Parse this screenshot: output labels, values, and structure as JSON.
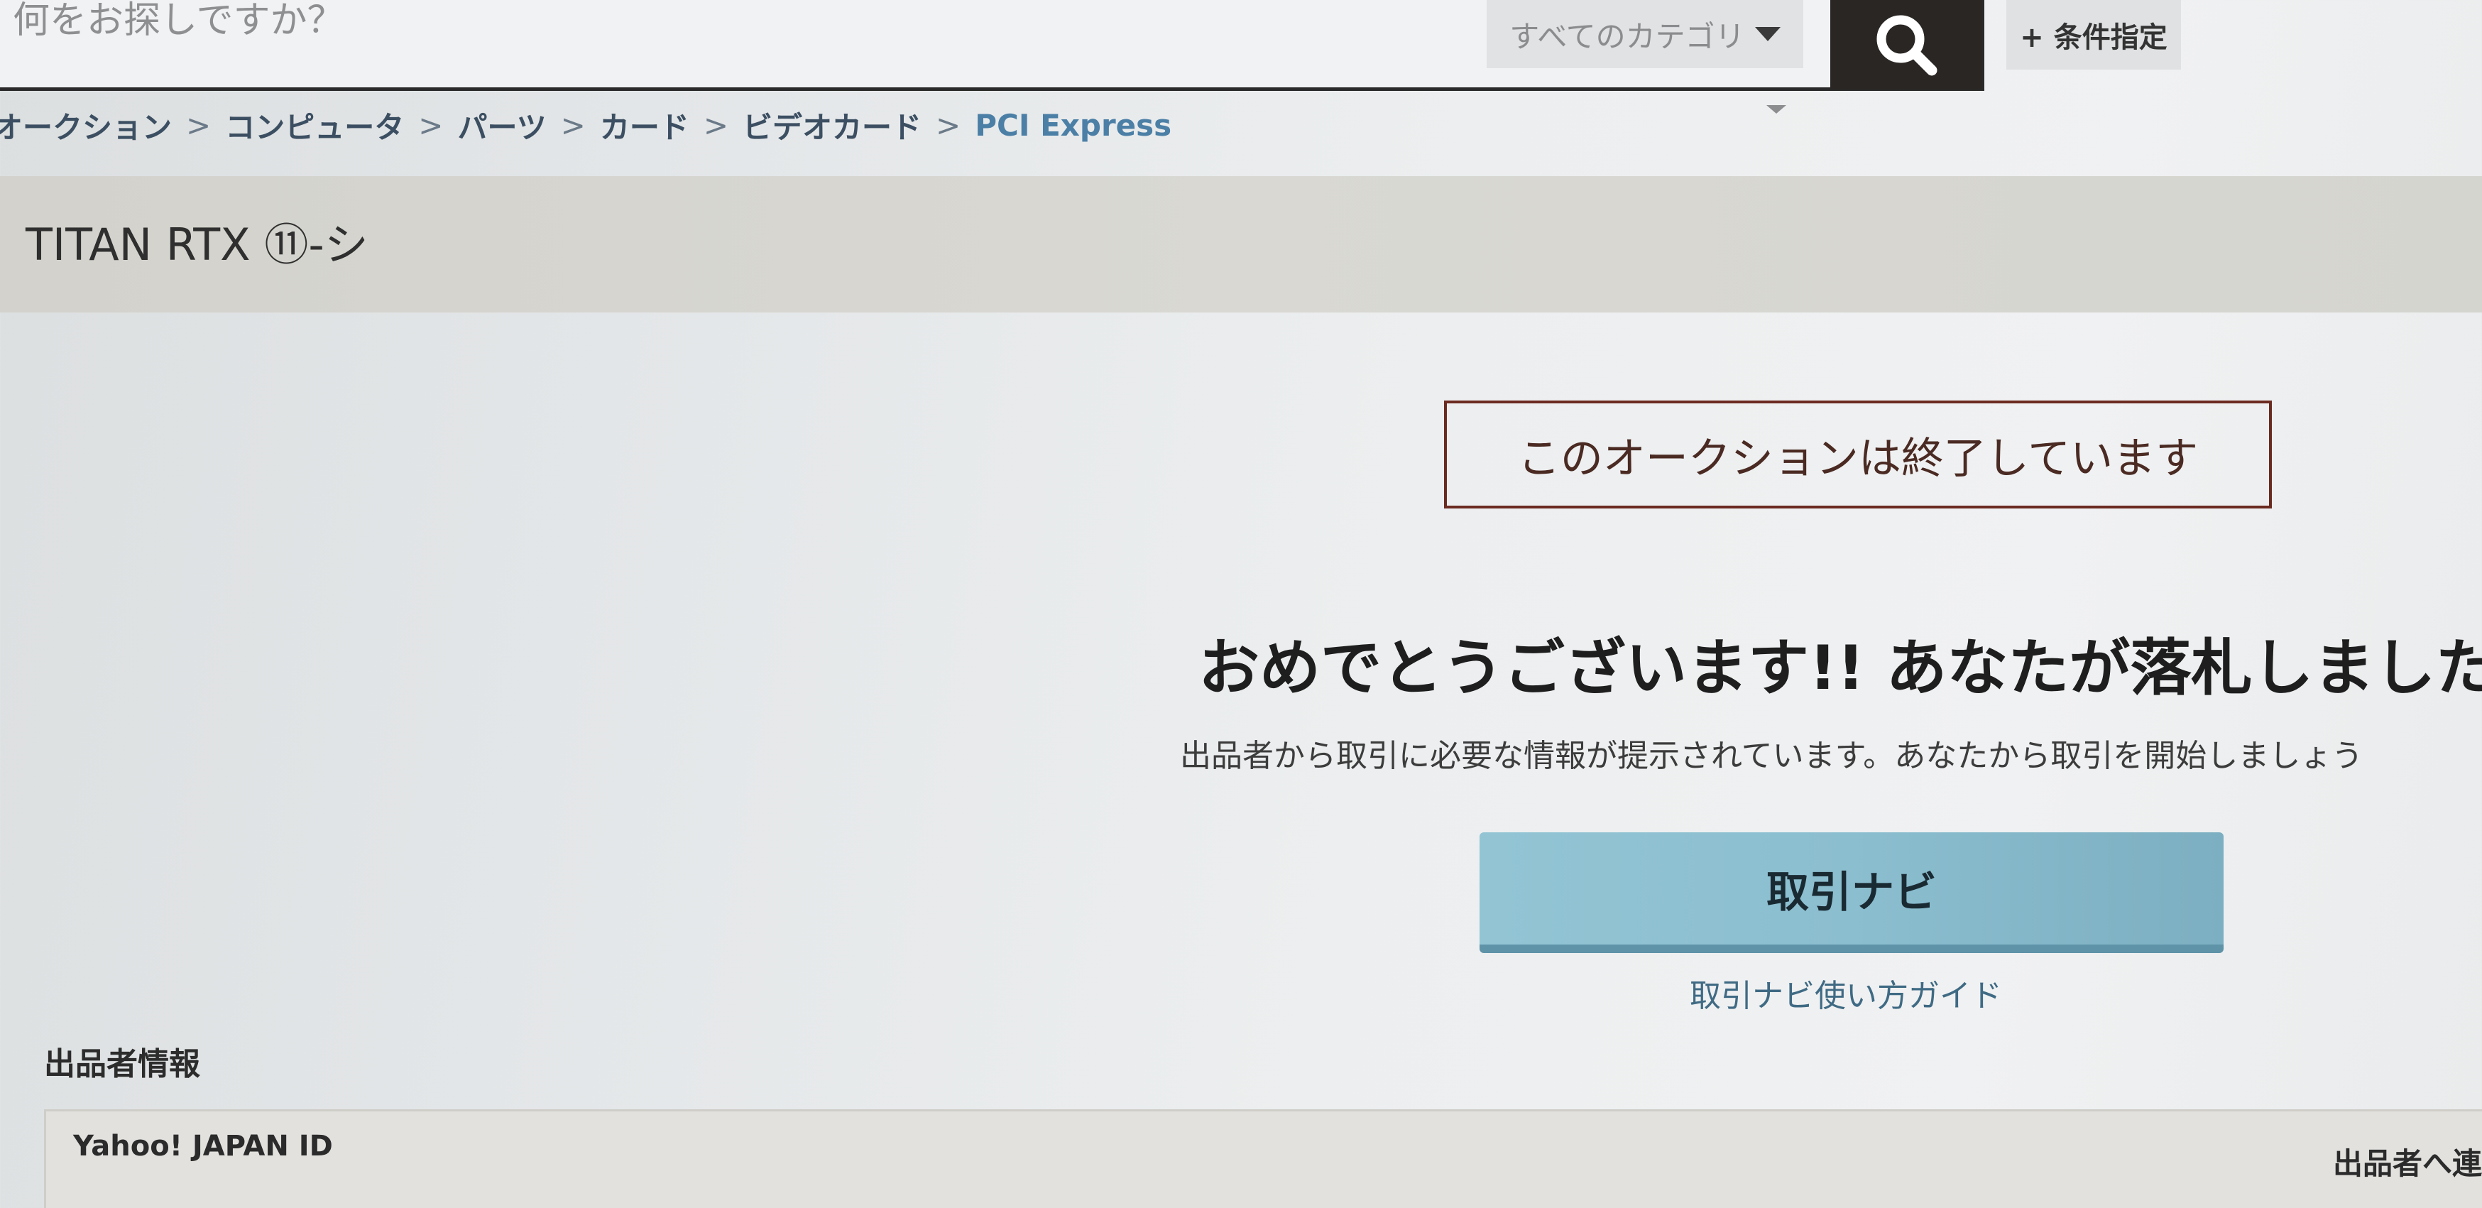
{
  "search": {
    "placeholder": "何をお探しですか？",
    "category_label": "すべてのカテゴリ",
    "conditions_label": "+ 条件指定"
  },
  "breadcrumb": [
    {
      "label": "オークション"
    },
    {
      "label": "コンピュータ"
    },
    {
      "label": "パーツ"
    },
    {
      "label": "カード"
    },
    {
      "label": "ビデオカード"
    },
    {
      "label": "PCI Express"
    }
  ],
  "breadcrumb_separator": ">",
  "item": {
    "title": "TITAN RTX ⑪-シ"
  },
  "auction": {
    "ended_notice": "このオークションは終了しています",
    "congrats_message": "おめでとうございます!! あなたが落札しました。",
    "instruction": "出品者から取引に必要な情報が提示されています。あなたから取引を開始しましょう",
    "trade_navi_button": "取引ナビ",
    "trade_navi_guide": "取引ナビ使い方ガイド"
  },
  "seller": {
    "heading": "出品者情報",
    "id_label": "Yahoo! JAPAN ID",
    "contact_label": "出品者へ連"
  },
  "colors": {
    "accent_button": "#8bbecf",
    "ended_border": "#6b2a20",
    "search_button": "#2a2624",
    "link": "#3f6a84"
  },
  "icons": {
    "search_button": "magnifier-icon",
    "category_dropdown": "caret-down-icon"
  }
}
